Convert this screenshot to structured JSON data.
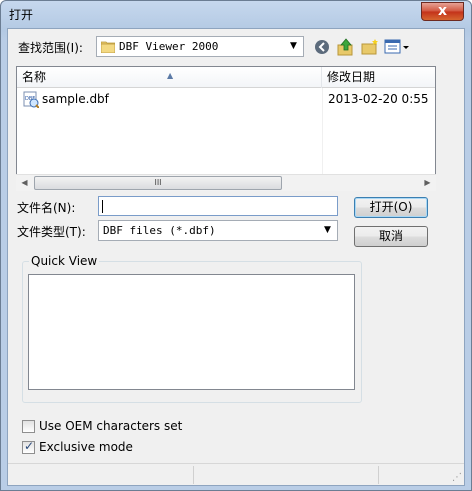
{
  "window": {
    "title": "打开",
    "close_glyph": "x"
  },
  "lookin": {
    "label": "查找范围(I):",
    "value": "DBF Viewer 2000"
  },
  "file_list": {
    "columns": [
      "名称",
      "修改日期"
    ],
    "rows": [
      {
        "name": "sample.dbf",
        "modified": "2013-02-20 0:55"
      }
    ],
    "scroll_thumb_glyph": "III"
  },
  "filename": {
    "label": "文件名(N):",
    "value": ""
  },
  "filetype": {
    "label": "文件类型(T):",
    "value": "DBF files (*.dbf)"
  },
  "buttons": {
    "open": "打开(O)",
    "cancel": "取消"
  },
  "quick_view": {
    "title": "Quick View"
  },
  "options": {
    "oem_label": "Use OEM characters set",
    "oem_checked": false,
    "exclusive_label": "Exclusive mode",
    "exclusive_checked": true
  },
  "colors": {
    "default_button_border": "#3c7fb1",
    "close_button": "#c3311a"
  }
}
